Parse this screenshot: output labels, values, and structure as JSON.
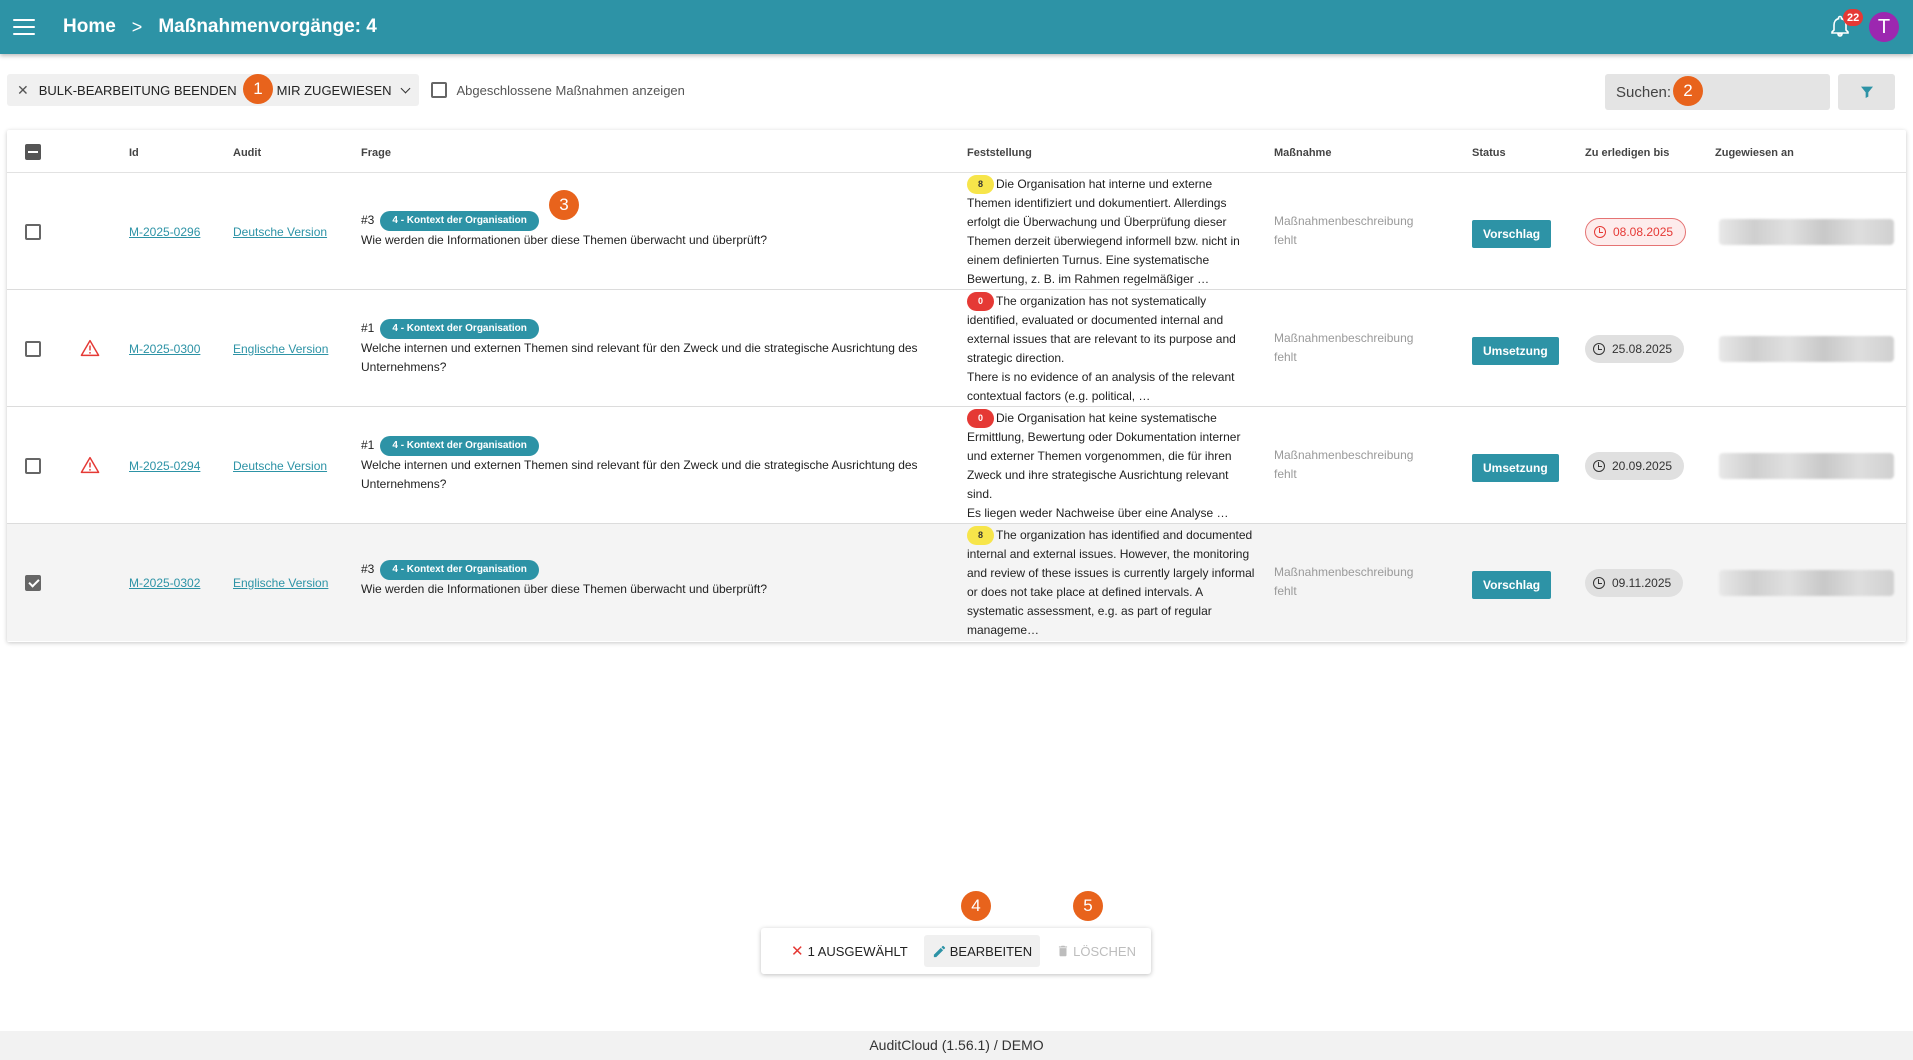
{
  "header": {
    "home": "Home",
    "separator": ">",
    "title": "Maßnahmenvorgänge: 4",
    "notification_count": "22",
    "avatar_initial": "T"
  },
  "toolbar": {
    "bulk_end_label": "BULK-BEARBEITUNG BEENDEN",
    "assigned_label": "MIR ZUGEWIESEN",
    "show_closed_label": "Abgeschlossene Maßnahmen anzeigen"
  },
  "search": {
    "label": "Suchen:",
    "value": ""
  },
  "markers": [
    "1",
    "2",
    "3",
    "4",
    "5"
  ],
  "table": {
    "headers": {
      "id": "Id",
      "audit": "Audit",
      "frage": "Frage",
      "feststellung": "Feststellung",
      "massnahme": "Maßnahme",
      "status": "Status",
      "due": "Zu erledigen bis",
      "assigned": "Zugewiesen an"
    },
    "rows": [
      {
        "id": "M-2025-0296",
        "audit": "Deutsche Version",
        "frage_num": "#3",
        "chip": "4 - Kontext der Organisation",
        "frage": "Wie werden die Informationen über diese Themen überwacht und überprüft?",
        "score": "8",
        "feststellung": "Die Organisation hat interne und externe Themen identifiziert und dokumentiert. Allerdings erfolgt die Überwachung und Überprüfung dieser Themen derzeit überwiegend informell bzw. nicht in einem definierten Turnus. Eine systematische Bewertung, z. B. im Rahmen regelmäßiger …",
        "massnahme": "Maßnahmenbeschreibung fehlt",
        "status": "Vorschlag",
        "due": "08.08.2025"
      },
      {
        "id": "M-2025-0300",
        "audit": "Englische Version",
        "frage_num": "#1",
        "chip": "4 - Kontext der Organisation",
        "frage": "Welche internen und externen Themen sind relevant für den Zweck und die strategische Ausrichtung des Unternehmens?",
        "score": "0",
        "feststellung": "The organization has not systematically identified, evaluated or documented internal and external issues that are relevant to its purpose and strategic direction.",
        "feststellung2": "There is no evidence of an analysis of the relevant contextual factors (e.g. political, …",
        "massnahme": "Maßnahmenbeschreibung fehlt",
        "status": "Umsetzung",
        "due": "25.08.2025"
      },
      {
        "id": "M-2025-0294",
        "audit": "Deutsche Version",
        "frage_num": "#1",
        "chip": "4 - Kontext der Organisation",
        "frage": "Welche internen und externen Themen sind relevant für den Zweck und die strategische Ausrichtung des Unternehmens?",
        "score": "0",
        "feststellung": "Die Organisation hat keine systematische Ermittlung, Bewertung oder Dokumentation interner und externer Themen vorgenommen, die für ihren Zweck und ihre strategische Ausrichtung relevant sind.",
        "feststellung2": "Es liegen weder Nachweise über eine Analyse …",
        "massnahme": "Maßnahmenbeschreibung fehlt",
        "status": "Umsetzung",
        "due": "20.09.2025"
      },
      {
        "id": "M-2025-0302",
        "audit": "Englische Version",
        "frage_num": "#3",
        "chip": "4 - Kontext der Organisation",
        "frage": "Wie werden die Informationen über diese Themen überwacht und überprüft?",
        "score": "8",
        "feststellung": "The organization has identified and documented internal and external issues. However, the monitoring and review of these issues is currently largely informal or does not take place at defined intervals. A systematic assessment, e.g. as part of regular manageme…",
        "massnahme": "Maßnahmenbeschreibung fehlt",
        "status": "Vorschlag",
        "due": "09.11.2025"
      }
    ]
  },
  "bulkbar": {
    "selected_label": "1 AUSGEWÄHLT",
    "edit_label": "BEARBEITEN",
    "delete_label": "LÖSCHEN"
  },
  "footer": {
    "text": "AuditCloud (1.56.1) / DEMO"
  },
  "colors": {
    "primary": "#2d93a6",
    "marker": "#e8631c",
    "danger": "#e53935",
    "score_yellow": "#f7e54a"
  }
}
